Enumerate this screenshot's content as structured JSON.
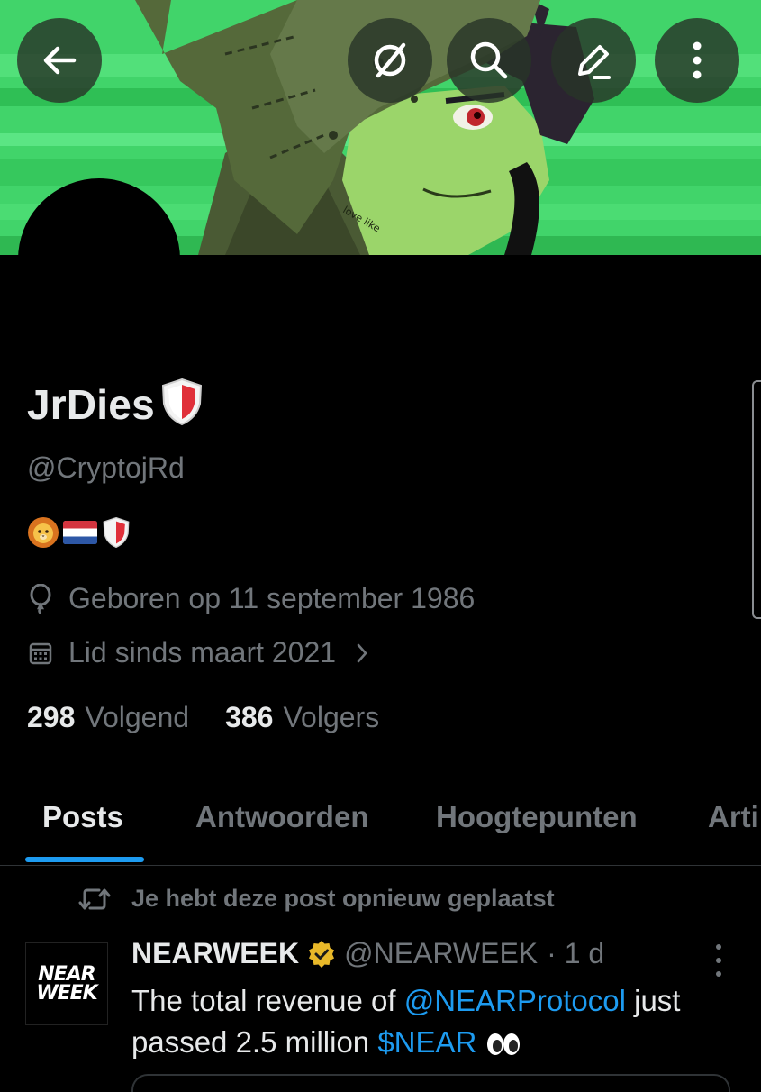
{
  "header": {
    "buttons": [
      {
        "name": "back-arrow-icon"
      },
      {
        "name": "grok-icon"
      },
      {
        "name": "search-icon"
      },
      {
        "name": "edit-icon"
      },
      {
        "name": "more-vertical-icon"
      }
    ],
    "banner_text": "love like"
  },
  "profile": {
    "display_name": "JrDies",
    "name_badge_icon": "red-white-shield-icon",
    "handle": "@CryptojRd",
    "bio_icons": [
      "lion-face-icon",
      "flag-netherlands-icon",
      "red-white-shield-icon"
    ],
    "birthday_icon": "balloon-icon",
    "birthday": "Geboren op 11 september 1986",
    "joined_icon": "calendar-icon",
    "joined": "Lid sinds maart 2021",
    "following_count": "298",
    "following_label": "Volgend",
    "followers_count": "386",
    "followers_label": "Volgers"
  },
  "tabs": [
    {
      "label": "Posts",
      "active": true
    },
    {
      "label": "Antwoorden",
      "active": false
    },
    {
      "label": "Hoogtepunten",
      "active": false
    },
    {
      "label": "Arti",
      "active": false
    }
  ],
  "post": {
    "repost_notice": "Je hebt deze post opnieuw geplaatst",
    "author_name": "NEARWEEK",
    "author_avatar_text_line1": "NEAR",
    "author_avatar_text_line2": "WEEK",
    "verified_badge": "gold-verified-icon",
    "author_handle": "@NEARWEEK",
    "time": "· 1 d",
    "text_part1": "The total revenue of ",
    "mention": "@NEARProtocol",
    "text_part2": " just passed 2.5 million ",
    "cashtag": "$NEAR",
    "text_emoji": "eyes-emoji-icon"
  },
  "colors": {
    "background": "#000000",
    "primary_text": "#e7e9ea",
    "secondary_text": "#71767b",
    "accent_blue": "#1d9bf0",
    "banner_green": "#3ecf66",
    "verified_gold": "#e8b829",
    "shield_red": "#e0303a"
  }
}
